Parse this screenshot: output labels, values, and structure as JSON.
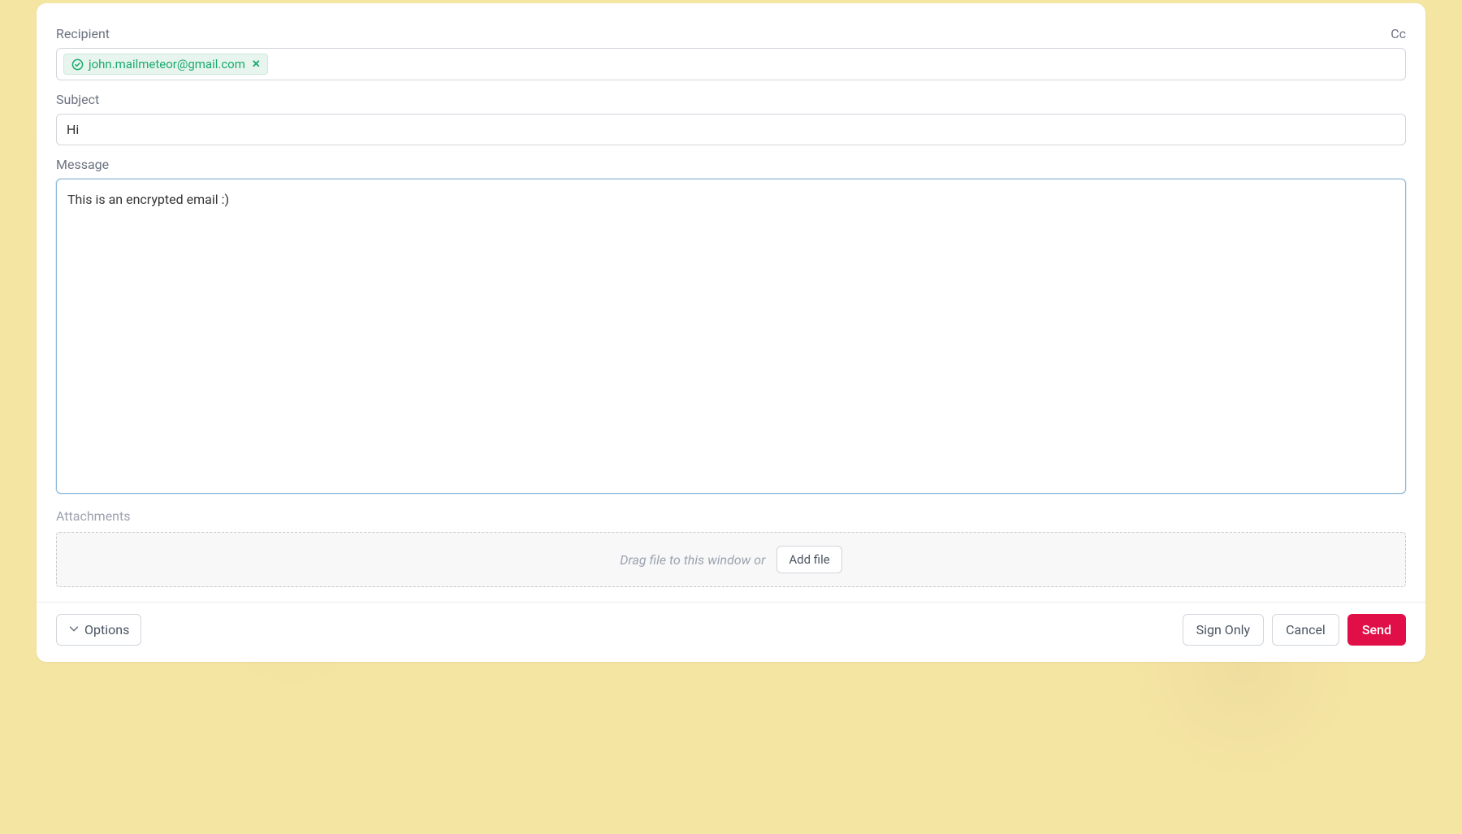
{
  "labels": {
    "recipient": "Recipient",
    "cc": "Cc",
    "subject": "Subject",
    "message": "Message",
    "attachments": "Attachments"
  },
  "recipient": {
    "chip_email": "john.mailmeteor@gmail.com"
  },
  "subject": {
    "value": "Hi"
  },
  "message": {
    "value": "This is an encrypted email :)"
  },
  "attachments": {
    "hint": "Drag file to this window or",
    "add_button": "Add file"
  },
  "footer": {
    "options": "Options",
    "sign_only": "Sign Only",
    "cancel": "Cancel",
    "send": "Send"
  }
}
